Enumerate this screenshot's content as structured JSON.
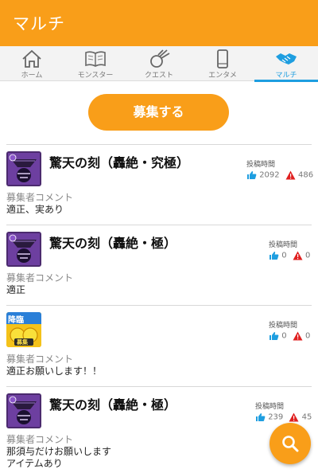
{
  "header": {
    "title": "マルチ"
  },
  "tabs": [
    {
      "label": "ホーム",
      "icon": "home-icon"
    },
    {
      "label": "モンスター",
      "icon": "book-icon"
    },
    {
      "label": "クエスト",
      "icon": "quest-icon"
    },
    {
      "label": "エンタメ",
      "icon": "phone-icon"
    },
    {
      "label": "マルチ",
      "icon": "handshake-icon",
      "active": true
    }
  ],
  "recruit_button": {
    "label": "募集する"
  },
  "colors": {
    "accent": "#f99e19",
    "active_tab": "#1e9ee0",
    "like": "#1e9ee0",
    "report": "#e02020"
  },
  "posts": [
    {
      "title": "驚天の刻（轟絶・究極）",
      "time_label": "投稿時間",
      "likes": "2092",
      "reports": "486",
      "comment_label": "募集者コメント",
      "comment": "適正、実あり",
      "thumb": "kokuten-thumb"
    },
    {
      "title": "驚天の刻（轟絶・極）",
      "time_label": "投稿時間",
      "likes": "0",
      "reports": "0",
      "comment_label": "募集者コメント",
      "comment": "適正",
      "thumb": "kokuten-thumb"
    },
    {
      "title": "",
      "time_label": "投稿時間",
      "likes": "0",
      "reports": "0",
      "comment_label": "募集者コメント",
      "comment": "適正お願いします！！",
      "thumb": "event-thumb",
      "thumb_text": "降臨",
      "thumb_badge": "募集"
    },
    {
      "title": "驚天の刻（轟絶・極）",
      "time_label": "投稿時間",
      "likes": "239",
      "reports": "45",
      "comment_label": "募集者コメント",
      "comment": "那須与だけお願いします",
      "comment2": "アイテムあり",
      "thumb": "kokuten-thumb"
    }
  ],
  "fab": {
    "icon": "search-icon"
  }
}
